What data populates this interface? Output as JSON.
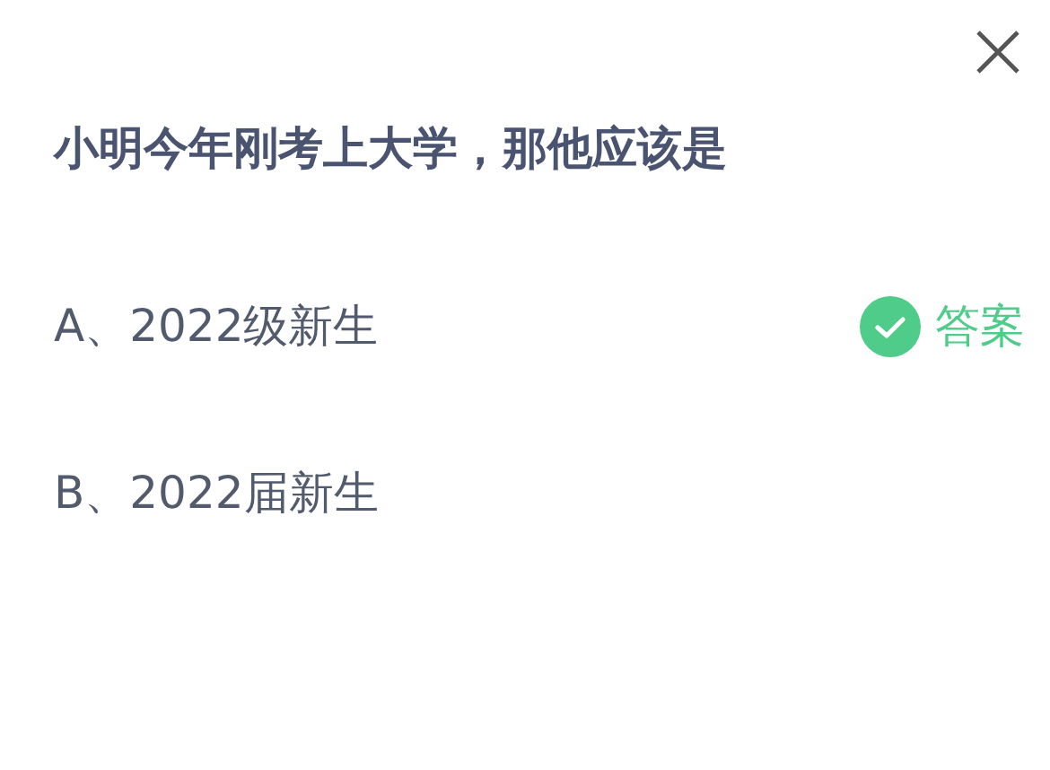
{
  "question": "小明今年刚考上大学，那他应该是",
  "options": [
    {
      "text": "A、2022级新生",
      "correct": true,
      "answer_label": "答案"
    },
    {
      "text": "B、2022届新生",
      "correct": false
    }
  ]
}
